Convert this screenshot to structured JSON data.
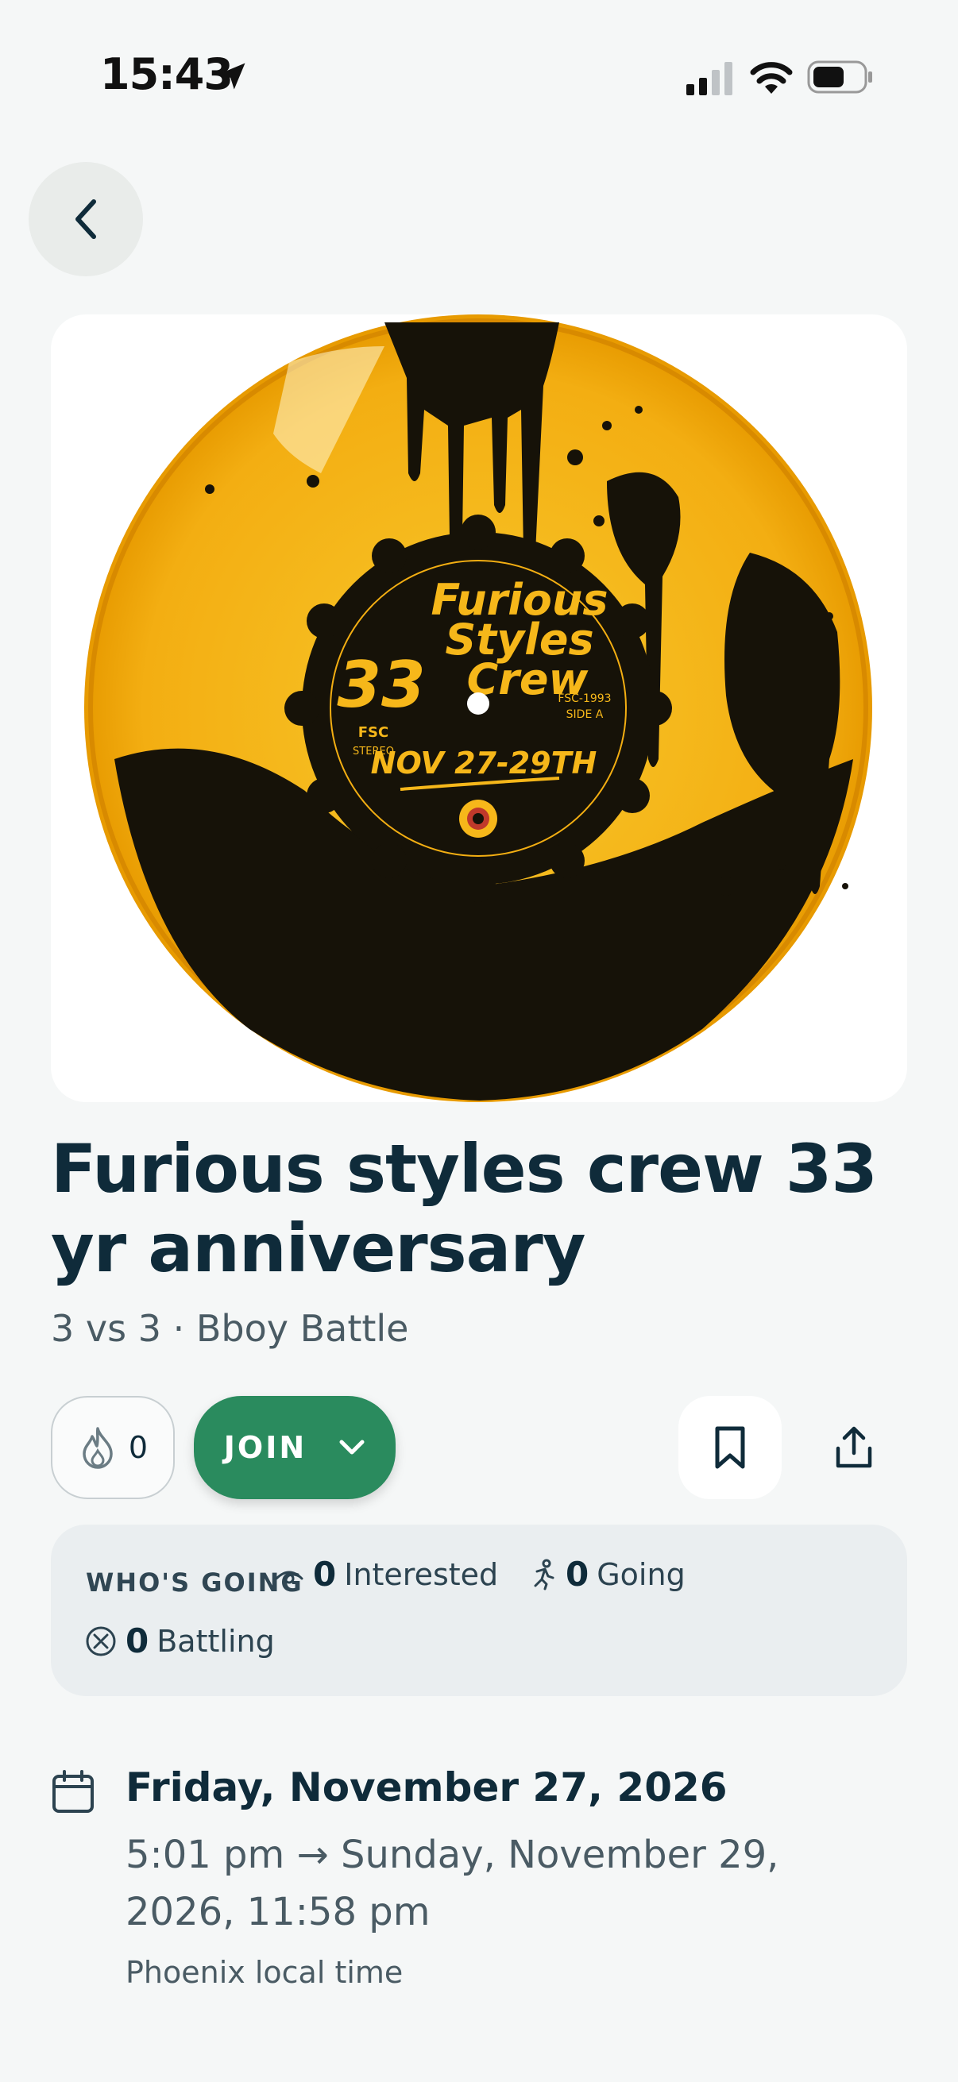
{
  "status_bar": {
    "time": "15:43"
  },
  "event": {
    "title": "Furious styles crew 33 yr anniversary",
    "subtitle": "3 vs 3 · Bboy Battle",
    "poster": {
      "crew_lines": [
        "Furious",
        "Styles",
        "Crew"
      ],
      "number": "33",
      "label_fsc": "FSC",
      "label_stereo": "STEREO",
      "catalog": "FSC-1993",
      "side": "SIDE A",
      "dates": "NOV 27-29TH"
    }
  },
  "actions": {
    "fire_count": "0",
    "join_label": "JOIN"
  },
  "whos_going": {
    "label": "WHO'S GOING",
    "interested_count": "0",
    "interested_label": "Interested",
    "going_count": "0",
    "going_label": "Going",
    "battling_count": "0",
    "battling_label": "Battling"
  },
  "schedule": {
    "date_title": "Friday, November 27, 2026",
    "time_range": "5:01 pm → Sunday, November 29, 2026, 11:58 pm",
    "timezone_note": "Phoenix local time"
  },
  "colors": {
    "accent_green": "#2a8b5e",
    "text_dark": "#0f2b3a",
    "record_yellow": "#f6b71a"
  }
}
